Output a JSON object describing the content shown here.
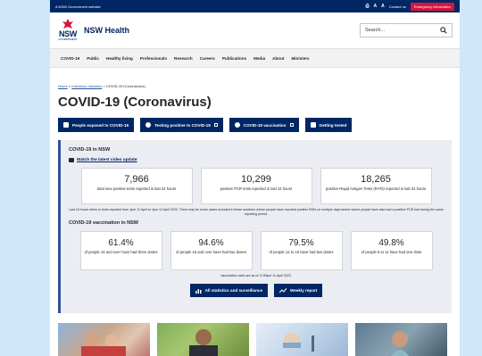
{
  "topbar": {
    "gov_label": "A NSW Government website",
    "contact": "Contact us",
    "emergency": "Emergency information"
  },
  "header": {
    "logo_text": "NSW",
    "logo_sub": "GOVERNMENT",
    "site_title": "NSW Health",
    "search_placeholder": "Search..."
  },
  "nav": [
    "COVID-19",
    "Public",
    "Healthy living",
    "Professionals",
    "Research",
    "Careers",
    "Publications",
    "Media",
    "About",
    "Ministers"
  ],
  "breadcrumb": {
    "home": "Home",
    "infectious": "Infectious diseases",
    "current": "COVID-19 (Coronavirus)"
  },
  "page_title": "COVID-19 (Coronavirus)",
  "quicklinks": [
    "People exposed to COVID-19",
    "Testing positive to COVID-19",
    "COVID-19 vaccination",
    "Getting tested"
  ],
  "panel": {
    "covid_heading": "COVID-19 in NSW",
    "video_link": "Watch the latest video update",
    "stats": [
      {
        "value": "7,966",
        "label": "total new positive tests reported in last 24 hours"
      },
      {
        "value": "10,299",
        "label": "positive PCR tests reported in last 24 hours"
      },
      {
        "value": "18,265",
        "label": "positive Rapid Antigen Tests (RATs) reported in last 24 hours"
      }
    ],
    "stats_note": "Last 24 hours refers to tests reported from 4pm 11 April to 4pm 12 April 2022. There may be some cases included in these numbers where people have reported positive RATs on multiple days and/or where people have also had a positive PCR test during the same reporting period.",
    "vax_heading": "COVID-19 vaccination in NSW",
    "vax": [
      {
        "value": "61.4%",
        "label": "of people 16 and over have had three doses"
      },
      {
        "value": "94.6%",
        "label": "of people 16 and over have had two doses"
      },
      {
        "value": "79.5%",
        "label": "of people 12 to 15 have had two doses"
      },
      {
        "value": "49.8%",
        "label": "of people 5 to 11 have had one dose"
      }
    ],
    "vax_note": "Vaccination rates are as of 11:59pm 11 April 2022.",
    "btn_all_stats": "All statistics and surveillance",
    "btn_weekly": "Weekly report"
  },
  "colors": {
    "navy": "#002664",
    "red": "#d7153a",
    "panel_bg": "#ebedf2",
    "accent": "#2e5299",
    "backdrop": "#cfe6fb"
  }
}
